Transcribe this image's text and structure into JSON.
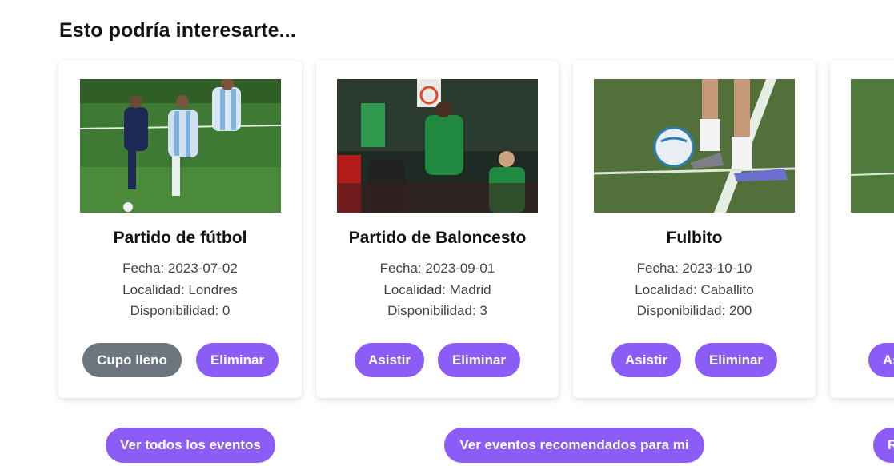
{
  "section": {
    "title": "Esto podría interesarte..."
  },
  "events": [
    {
      "title": "Partido de fútbol",
      "date_label": "Fecha: 2023-07-02",
      "location_label": "Localidad: Londres",
      "availability_label": "Disponibilidad: 0",
      "primary_action": "Cupo lleno",
      "delete_action": "Eliminar"
    },
    {
      "title": "Partido de Baloncesto",
      "date_label": "Fecha: 2023-09-01",
      "location_label": "Localidad: Madrid",
      "availability_label": "Disponibilidad: 3",
      "primary_action": "Asistir",
      "delete_action": "Eliminar"
    },
    {
      "title": "Fulbito",
      "date_label": "Fecha: 2023-10-10",
      "location_label": "Localidad: Caballito",
      "availability_label": "Disponibilidad: 200",
      "primary_action": "Asistir",
      "delete_action": "Eliminar"
    },
    {
      "primary_action": "As"
    }
  ],
  "bottom_actions": {
    "all_events": "Ver todos los eventos",
    "recommended_events": "Ver eventos recomendados para mi",
    "partial": "R"
  },
  "colors": {
    "accent": "#8b5cf6",
    "disabled": "#6c757d"
  }
}
